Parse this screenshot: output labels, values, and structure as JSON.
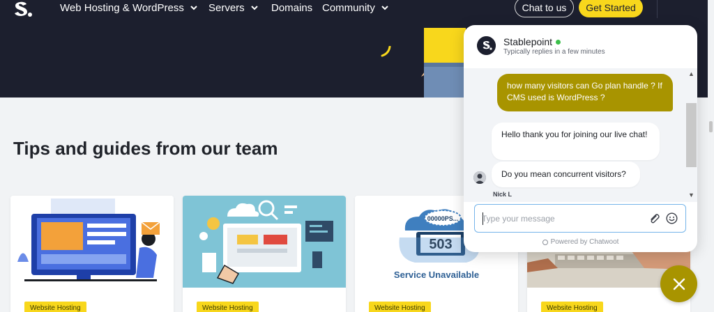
{
  "nav": {
    "items": [
      {
        "label": "Web Hosting & WordPress",
        "has_dropdown": true
      },
      {
        "label": "Servers",
        "has_dropdown": true
      },
      {
        "label": "Domains",
        "has_dropdown": false
      },
      {
        "label": "Community",
        "has_dropdown": true
      }
    ],
    "chat_button": "Chat to us",
    "start_button": "Get Started"
  },
  "section": {
    "title": "Tips and guides from our team"
  },
  "cards": [
    {
      "badge": "Website Hosting",
      "image": "illustration-website-design"
    },
    {
      "badge": "Website Hosting",
      "image": "illustration-web-development"
    },
    {
      "badge": "Website Hosting",
      "image": "illustration-503-error",
      "image_text": "Service Unavailable",
      "image_code": "503",
      "image_bubble": "00000PS..."
    },
    {
      "badge": "Website Hosting",
      "image": "photo-keyboard-typing"
    }
  ],
  "chat": {
    "name": "Stablepoint",
    "status": "Typically replies in a few minutes",
    "messages": [
      {
        "from": "visitor",
        "text": "how many visitors can Go plan handle ? If CMS used is WordPress ?"
      },
      {
        "from": "agent",
        "text": "Hello thank you for joining our live chat!"
      },
      {
        "from": "agent",
        "text": "Do you mean concurrent visitors?"
      }
    ],
    "agent_name": "Nick L",
    "input_placeholder": "Type your message",
    "powered_by": "Powered by Chatwoot"
  },
  "colors": {
    "header_bg": "#1c1f2e",
    "accent_yellow": "#f8d71c",
    "chat_accent": "#a89400",
    "online": "#3bbf4a"
  }
}
